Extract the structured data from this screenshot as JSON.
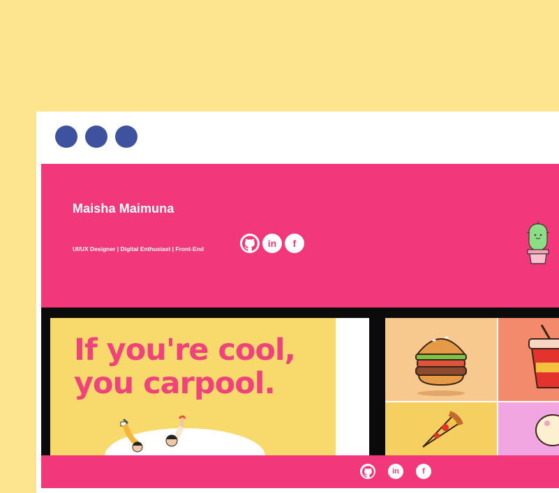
{
  "window": {
    "dot_color": "#3f52a0"
  },
  "header": {
    "name": "Maisha Maimuna",
    "tagline": "UI/UX Designer | Digital Enthusiast | Front-End",
    "social_icons": [
      "github-icon",
      "linkedin-icon",
      "facebook-icon"
    ],
    "linkedin_glyph": "in",
    "facebook_glyph": "f",
    "background_color": "#f2387a"
  },
  "gallery": {
    "poster": {
      "line1": "If you're cool,",
      "line2": "you carpool."
    },
    "food_tiles": [
      "burger",
      "drink",
      "pizza",
      "ice-cream"
    ]
  },
  "footer": {
    "social_icons": [
      "github-icon",
      "linkedin-icon",
      "facebook-icon"
    ],
    "linkedin_glyph": "in",
    "facebook_glyph": "f"
  }
}
